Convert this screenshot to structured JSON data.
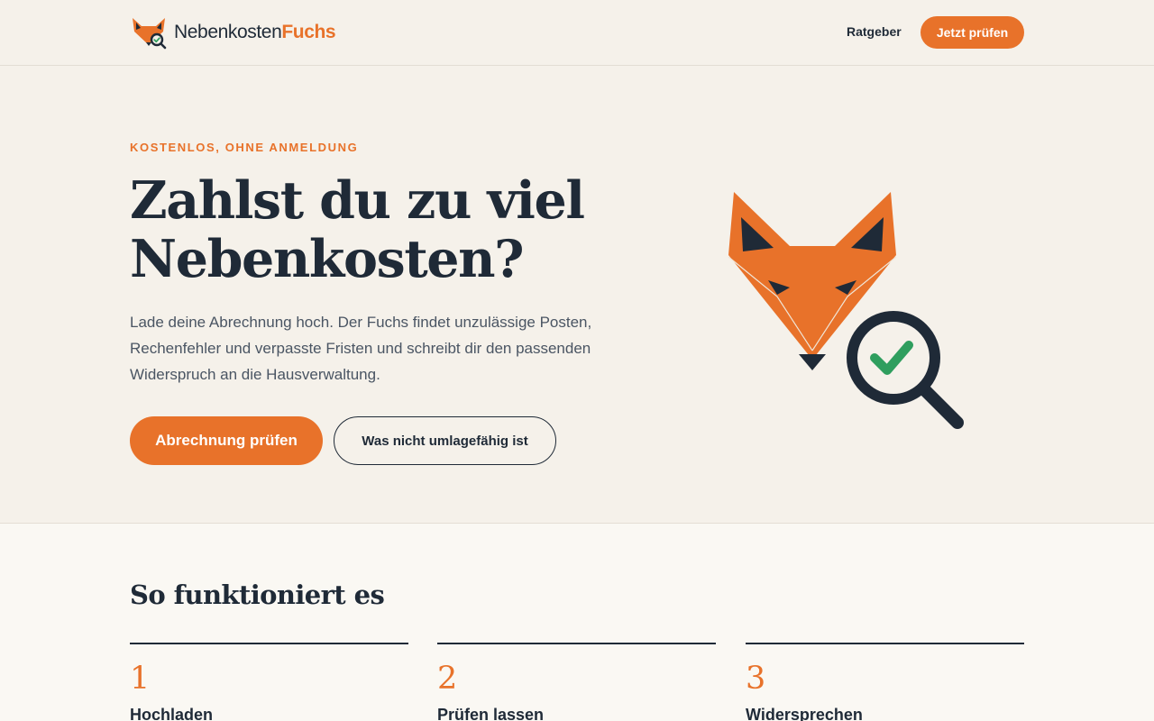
{
  "header": {
    "logo": {
      "text_main": "Nebenkosten",
      "text_accent": "Fuchs",
      "icon": "fox-magnifier-icon"
    },
    "nav": [
      {
        "label": "Ratgeber"
      }
    ],
    "cta_label": "Jetzt prüfen"
  },
  "hero": {
    "eyebrow": "KOSTENLOS, OHNE ANMELDUNG",
    "title": "Zahlst du zu viel Nebenkosten?",
    "lead": "Lade deine Abrechnung hoch. Der Fuchs findet unzulässige Posten, Rechenfehler und verpasste Fristen und schreibt dir den passenden Widerspruch an die Hausverwaltung.",
    "primary_button": "Abrechnung prüfen",
    "secondary_button": "Was nicht umlagefähig ist",
    "illustration": "fox-with-magnifier-check-icon"
  },
  "how_it_works": {
    "title": "So funktioniert es",
    "steps": [
      {
        "number": "1",
        "title": "Hochladen"
      },
      {
        "number": "2",
        "title": "Prüfen lassen"
      },
      {
        "number": "3",
        "title": "Widersprechen"
      }
    ]
  },
  "colors": {
    "accent": "#e8722a",
    "ink": "#1f2a37",
    "background": "#f5f1ea",
    "check_green": "#2f9e5e"
  }
}
